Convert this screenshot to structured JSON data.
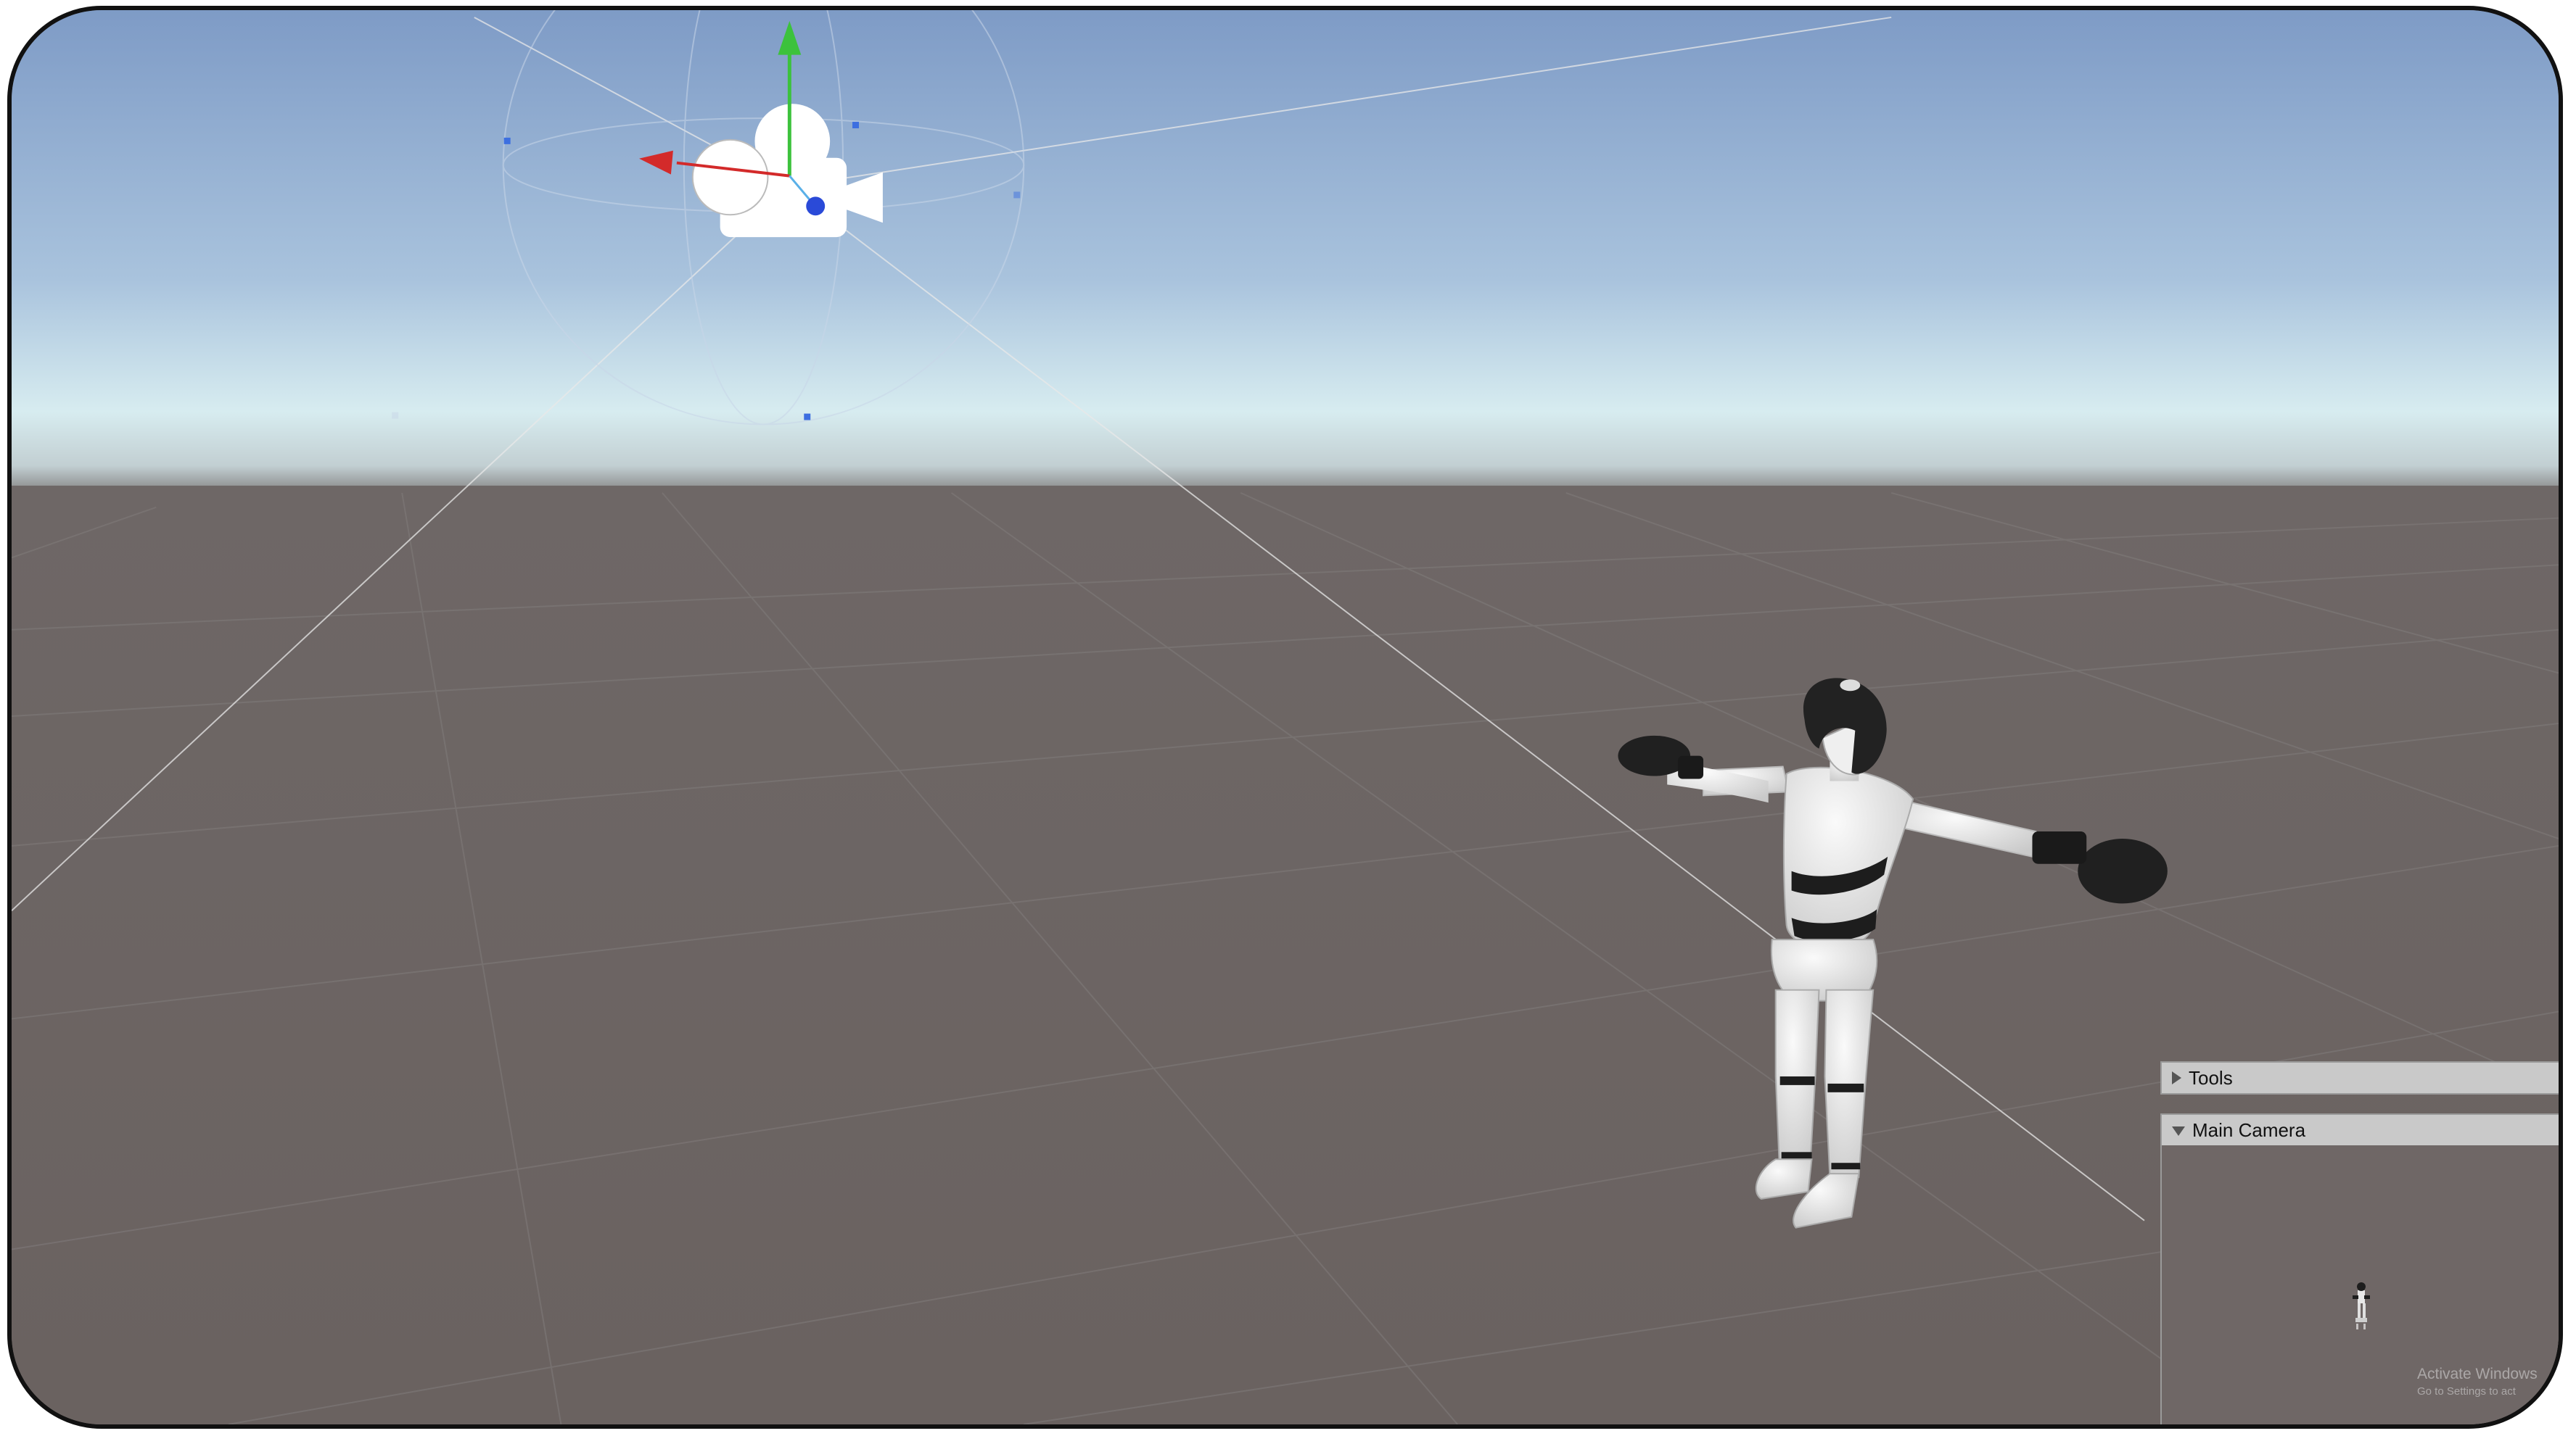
{
  "scene_view": {
    "gizmos": {
      "camera_icon": "camera-icon",
      "axis_colors": {
        "x": "#d32a2a",
        "y": "#3cc23c",
        "z": "#2a4ad8"
      }
    },
    "colors": {
      "sky_top": "#7f9cc7",
      "horizon": "#dceef1",
      "ground": "#6d6563"
    }
  },
  "panels": {
    "tools": {
      "label": "Tools",
      "expanded": false
    },
    "camera_preview": {
      "label": "Main Camera",
      "expanded": true
    }
  },
  "watermark": {
    "line1": "Activate Windows",
    "line2": "Go to Settings to act"
  }
}
